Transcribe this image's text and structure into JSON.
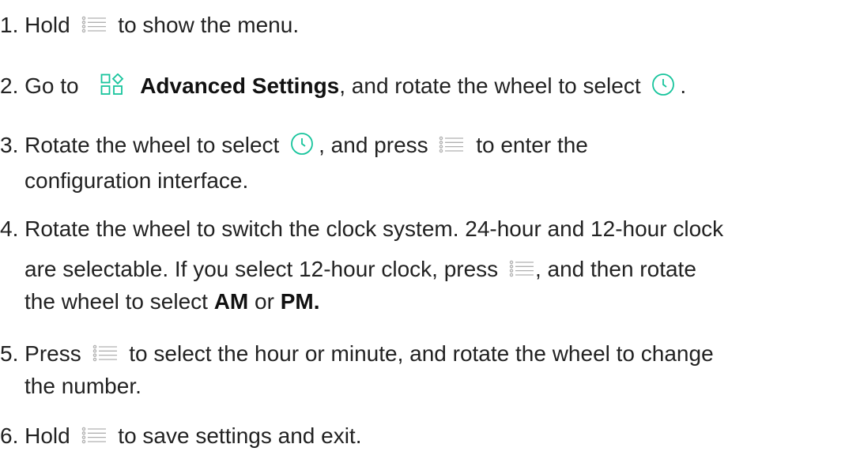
{
  "colors": {
    "accent": "#17c49c",
    "icon_gray": "#b0b0b0",
    "text": "#222222"
  },
  "icons": {
    "menu": "menu-list-icon",
    "clock": "clock-icon",
    "advanced": "advanced-settings-icon"
  },
  "steps": [
    {
      "num": "1.",
      "a": "Hold",
      "b": "to show the menu."
    },
    {
      "num": "2.",
      "a": "Go to",
      "bold": "Advanced Settings",
      "b": ", and rotate the wheel to select",
      "c": "."
    },
    {
      "num": "3.",
      "a": "Rotate the wheel to select",
      "b": ", and press",
      "c": "to enter the",
      "d": "configuration interface."
    },
    {
      "num": "4.",
      "a": "Rotate the wheel to switch the clock system. 24-hour and 12-hour clock",
      "b": "are selectable. If you select 12-hour clock, press",
      "c": ", and then rotate",
      "d": "the wheel to select",
      "am": "AM",
      "or": "or",
      "pm": "PM."
    },
    {
      "num": "5.",
      "a": "Press",
      "b": "to select the hour or minute, and rotate the wheel to change",
      "c": "the number."
    },
    {
      "num": "6.",
      "a": "Hold",
      "b": "to save settings and exit."
    }
  ]
}
